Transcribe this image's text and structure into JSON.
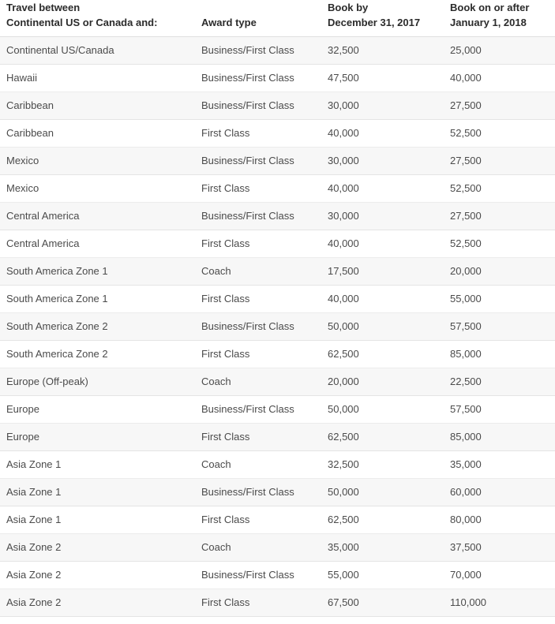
{
  "table": {
    "columns": [
      {
        "key": "route",
        "label_lines": [
          "Travel between",
          "Continental US or Canada and:"
        ]
      },
      {
        "key": "award",
        "label_lines": [
          "",
          "Award type"
        ]
      },
      {
        "key": "before",
        "label_lines": [
          "Book by",
          "December 31, 2017"
        ]
      },
      {
        "key": "after",
        "label_lines": [
          "Book on or after",
          "January 1, 2018"
        ]
      }
    ],
    "rows": [
      {
        "route": "Continental US/Canada",
        "award": "Business/First Class",
        "before": "32,500",
        "after": "25,000"
      },
      {
        "route": "Hawaii",
        "award": "Business/First Class",
        "before": "47,500",
        "after": "40,000"
      },
      {
        "route": "Caribbean",
        "award": "Business/First Class",
        "before": "30,000",
        "after": "27,500"
      },
      {
        "route": "Caribbean",
        "award": "First Class",
        "before": "40,000",
        "after": "52,500"
      },
      {
        "route": "Mexico",
        "award": "Business/First Class",
        "before": "30,000",
        "after": "27,500"
      },
      {
        "route": "Mexico",
        "award": "First Class",
        "before": "40,000",
        "after": "52,500"
      },
      {
        "route": "Central America",
        "award": "Business/First Class",
        "before": "30,000",
        "after": "27,500"
      },
      {
        "route": "Central America",
        "award": "First Class",
        "before": "40,000",
        "after": "52,500"
      },
      {
        "route": "South America Zone 1",
        "award": "Coach",
        "before": "17,500",
        "after": "20,000"
      },
      {
        "route": "South America Zone 1",
        "award": "First Class",
        "before": "40,000",
        "after": "55,000"
      },
      {
        "route": "South America Zone 2",
        "award": "Business/First Class",
        "before": "50,000",
        "after": "57,500"
      },
      {
        "route": "South America Zone 2",
        "award": "First Class",
        "before": "62,500",
        "after": "85,000"
      },
      {
        "route": "Europe (Off-peak)",
        "award": "Coach",
        "before": "20,000",
        "after": "22,500"
      },
      {
        "route": "Europe",
        "award": "Business/First Class",
        "before": "50,000",
        "after": "57,500"
      },
      {
        "route": "Europe",
        "award": "First Class",
        "before": "62,500",
        "after": "85,000"
      },
      {
        "route": "Asia Zone 1",
        "award": "Coach",
        "before": "32,500",
        "after": "35,000"
      },
      {
        "route": "Asia Zone 1",
        "award": "Business/First Class",
        "before": "50,000",
        "after": "60,000"
      },
      {
        "route": "Asia Zone 1",
        "award": "First Class",
        "before": "62,500",
        "after": "80,000"
      },
      {
        "route": "Asia Zone 2",
        "award": "Coach",
        "before": "35,000",
        "after": "37,500"
      },
      {
        "route": "Asia Zone 2",
        "award": "Business/First Class",
        "before": "55,000",
        "after": "70,000"
      },
      {
        "route": "Asia Zone 2",
        "award": "First Class",
        "before": "67,500",
        "after": "110,000"
      }
    ]
  },
  "colors": {
    "header_text": "#2b2b2b",
    "body_text": "#4b4b4b",
    "row_shaded": "#f7f7f7",
    "row_plain": "#ffffff",
    "row_border": "#e3e3e3",
    "background": "#ffffff"
  }
}
